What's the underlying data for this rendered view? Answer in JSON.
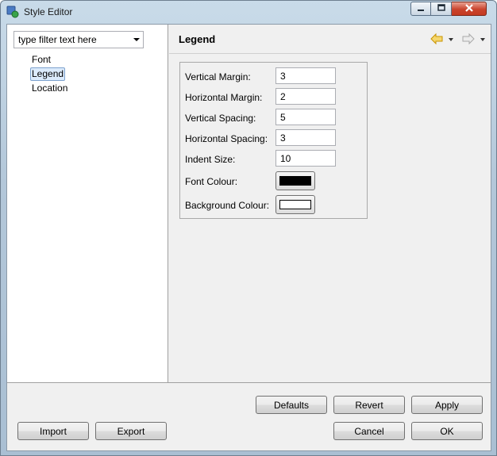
{
  "window": {
    "title": "Style Editor"
  },
  "filter": {
    "placeholder": "type filter text here"
  },
  "tree": {
    "items": [
      {
        "label": "Font"
      },
      {
        "label": "Legend",
        "selected": true
      },
      {
        "label": "Location"
      }
    ]
  },
  "page": {
    "title": "Legend",
    "fields": [
      {
        "label": "Vertical Margin:",
        "value": "3"
      },
      {
        "label": "Horizontal Margin:",
        "value": "2"
      },
      {
        "label": "Vertical Spacing:",
        "value": "5"
      },
      {
        "label": "Horizontal Spacing:",
        "value": "3"
      },
      {
        "label": "Indent Size:",
        "value": "10"
      }
    ],
    "colors": [
      {
        "label": "Font Colour:",
        "color": "#000000"
      },
      {
        "label": "Background Colour:",
        "color": "#ffffff"
      }
    ]
  },
  "buttons": {
    "defaults": "Defaults",
    "revert": "Revert",
    "apply": "Apply",
    "import": "Import",
    "export": "Export",
    "cancel": "Cancel",
    "ok": "OK"
  },
  "icons": {
    "app": "style-editor-icon",
    "back": "back-arrow-icon",
    "forward": "forward-arrow-icon",
    "back_color": "#f0b400",
    "forward_color": "#c8c8c8"
  }
}
